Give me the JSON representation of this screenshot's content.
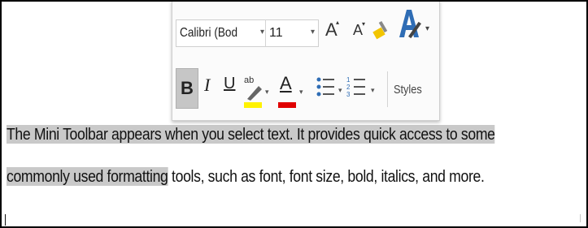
{
  "toolbar": {
    "font_name": "Calibri (Bod",
    "font_size": "11",
    "bold_label": "B",
    "italic_label": "I",
    "underline_label": "U",
    "styles_label": "Styles",
    "highlight_color": "#fff200",
    "font_color": "#e00000"
  },
  "document": {
    "line1_selected": "The Mini Toolbar appears when you select text. It provides quick access to some",
    "line2_selected": "commonly used formatting",
    "line2_unselected": " tools, such as font, font size, bold, italics, and more."
  },
  "icons": [
    "grow-font-icon",
    "shrink-font-icon",
    "clear-formatting-icon",
    "styles-pane-icon",
    "highlight-icon",
    "font-color-icon",
    "bullets-icon",
    "numbering-icon"
  ]
}
